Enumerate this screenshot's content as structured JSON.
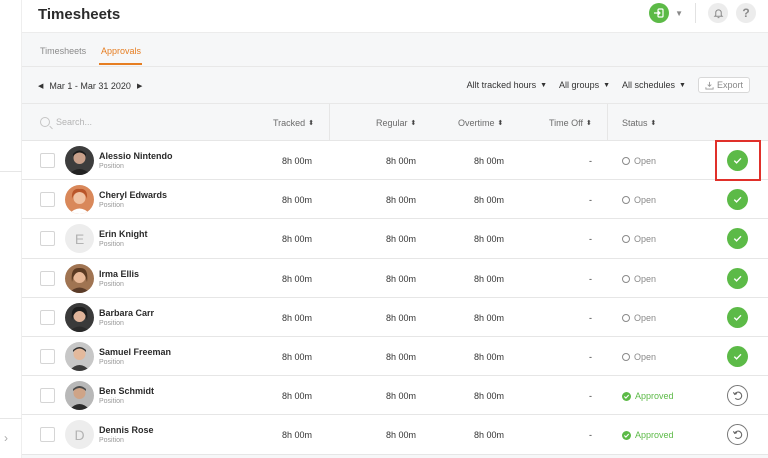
{
  "header": {
    "title": "Timesheets"
  },
  "tabs": [
    {
      "label": "Timesheets",
      "active": false
    },
    {
      "label": "Approvals",
      "active": true
    }
  ],
  "filters": {
    "date_range": "Mar 1  - Mar 31 2020",
    "tracked_hours": "Allt tracked hours",
    "groups": "All groups",
    "schedules": "All schedules",
    "export_label": "Export"
  },
  "table": {
    "search_placeholder": "Search...",
    "columns": {
      "tracked": "Tracked",
      "regular": "Regular",
      "overtime": "Overtime",
      "time_off": "Time Off",
      "status": "Status"
    },
    "rows": [
      {
        "name": "Alessio Nintendo",
        "position": "Position",
        "tracked": "8h 00m",
        "regular": "8h 00m",
        "overtime": "8h 00m",
        "time_off": "-",
        "status": "Open",
        "avatar": "photo",
        "action": "approve"
      },
      {
        "name": "Cheryl Edwards",
        "position": "Position",
        "tracked": "8h 00m",
        "regular": "8h 00m",
        "overtime": "8h 00m",
        "time_off": "-",
        "status": "Open",
        "avatar": "photo",
        "action": "approve"
      },
      {
        "name": "Erin Knight",
        "position": "Position",
        "tracked": "8h 00m",
        "regular": "8h 00m",
        "overtime": "8h 00m",
        "time_off": "-",
        "status": "Open",
        "avatar": "E",
        "action": "approve"
      },
      {
        "name": "Irma Ellis",
        "position": "Position",
        "tracked": "8h 00m",
        "regular": "8h 00m",
        "overtime": "8h 00m",
        "time_off": "-",
        "status": "Open",
        "avatar": "photo",
        "action": "approve"
      },
      {
        "name": "Barbara Carr",
        "position": "Position",
        "tracked": "8h 00m",
        "regular": "8h 00m",
        "overtime": "8h 00m",
        "time_off": "-",
        "status": "Open",
        "avatar": "photo",
        "action": "approve"
      },
      {
        "name": "Samuel Freeman",
        "position": "Position",
        "tracked": "8h 00m",
        "regular": "8h 00m",
        "overtime": "8h 00m",
        "time_off": "-",
        "status": "Open",
        "avatar": "photo",
        "action": "approve"
      },
      {
        "name": "Ben Schmidt",
        "position": "Position",
        "tracked": "8h 00m",
        "regular": "8h 00m",
        "overtime": "8h 00m",
        "time_off": "-",
        "status": "Approved",
        "avatar": "photo",
        "action": "undo"
      },
      {
        "name": "Dennis Rose",
        "position": "Position",
        "tracked": "8h 00m",
        "regular": "8h 00m",
        "overtime": "8h 00m",
        "time_off": "-",
        "status": "Approved",
        "avatar": "D",
        "action": "undo"
      }
    ]
  },
  "colors": {
    "accent": "#e67e22",
    "approve_green": "#5cba47",
    "highlight_red": "#e0302a"
  }
}
